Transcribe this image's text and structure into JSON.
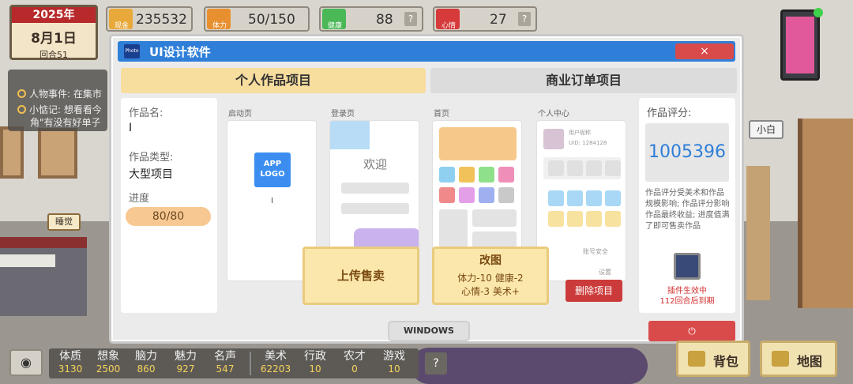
{
  "hud": {
    "year": "2025年",
    "date": "8月1日",
    "round": "回合51",
    "money": {
      "label": "现金",
      "value": "235532"
    },
    "stamina": {
      "label": "体力",
      "value": "50/150"
    },
    "health": {
      "label": "健康",
      "value": "88",
      "help": "?"
    },
    "mood": {
      "label": "心情",
      "value": "27",
      "help": "?"
    }
  },
  "background": {
    "event_1": "人物事件: 在集市",
    "event_2": "小惦记: 想看看今",
    "event_3": "角\"有没有好单子",
    "sleep_label": "睡觉",
    "npc_name": "小白"
  },
  "window": {
    "title": "UI设计软件",
    "app_icon": "Photo",
    "close": "×",
    "tabs": [
      {
        "label": "个人作品项目",
        "active": true
      },
      {
        "label": "商业订单项目",
        "active": false
      }
    ],
    "info": {
      "name_label": "作品名:",
      "name_value": "I",
      "type_label": "作品类型:",
      "type_value": "大型项目",
      "progress_label": "进度",
      "progress_text": "80/80",
      "progress": 1.0
    },
    "pages": [
      {
        "label": "启动页",
        "logo": "APP LOGO",
        "cursor": "I"
      },
      {
        "label": "登录页",
        "welcome": "欢迎"
      },
      {
        "label": "首页"
      },
      {
        "label": "个人中心",
        "username": "用户昵称",
        "uid": "UID: 1284128",
        "security": "账号安全",
        "settings": "设置"
      }
    ],
    "actions": {
      "upload": "上传售卖",
      "edit_title": "改图",
      "edit_cost_1": "体力-10 健康-2",
      "edit_cost_2": "心情-3 美术+",
      "delete": "删除项目"
    },
    "score": {
      "label": "作品评分:",
      "value": "1005396",
      "note": "作品评分受美术和作品规模影响; 作品评分影响作品最终收益; 进度值满了即可售卖作品",
      "plugin_1": "插件生效中",
      "plugin_2": "112回合后到期"
    },
    "windows_button": "WINDOWS",
    "power_button": "⏻"
  },
  "bottom": {
    "eye": "◉",
    "stats": [
      {
        "name": "体质",
        "value": "3130"
      },
      {
        "name": "想象",
        "value": "2500"
      },
      {
        "name": "脑力",
        "value": "860"
      },
      {
        "name": "魅力",
        "value": "927"
      },
      {
        "name": "名声",
        "value": "547"
      },
      {
        "name": "美术",
        "value": "62203"
      },
      {
        "name": "行政",
        "value": "10"
      },
      {
        "name": "农才",
        "value": "0"
      },
      {
        "name": "游戏",
        "value": "10"
      }
    ],
    "help": "?",
    "bag": "背包",
    "map": "地图"
  },
  "colors": {
    "accent": "#2f7fd8",
    "tab_active": "#f7dd9e",
    "danger": "#d94b4b",
    "stat_value": "#f5d35a"
  }
}
